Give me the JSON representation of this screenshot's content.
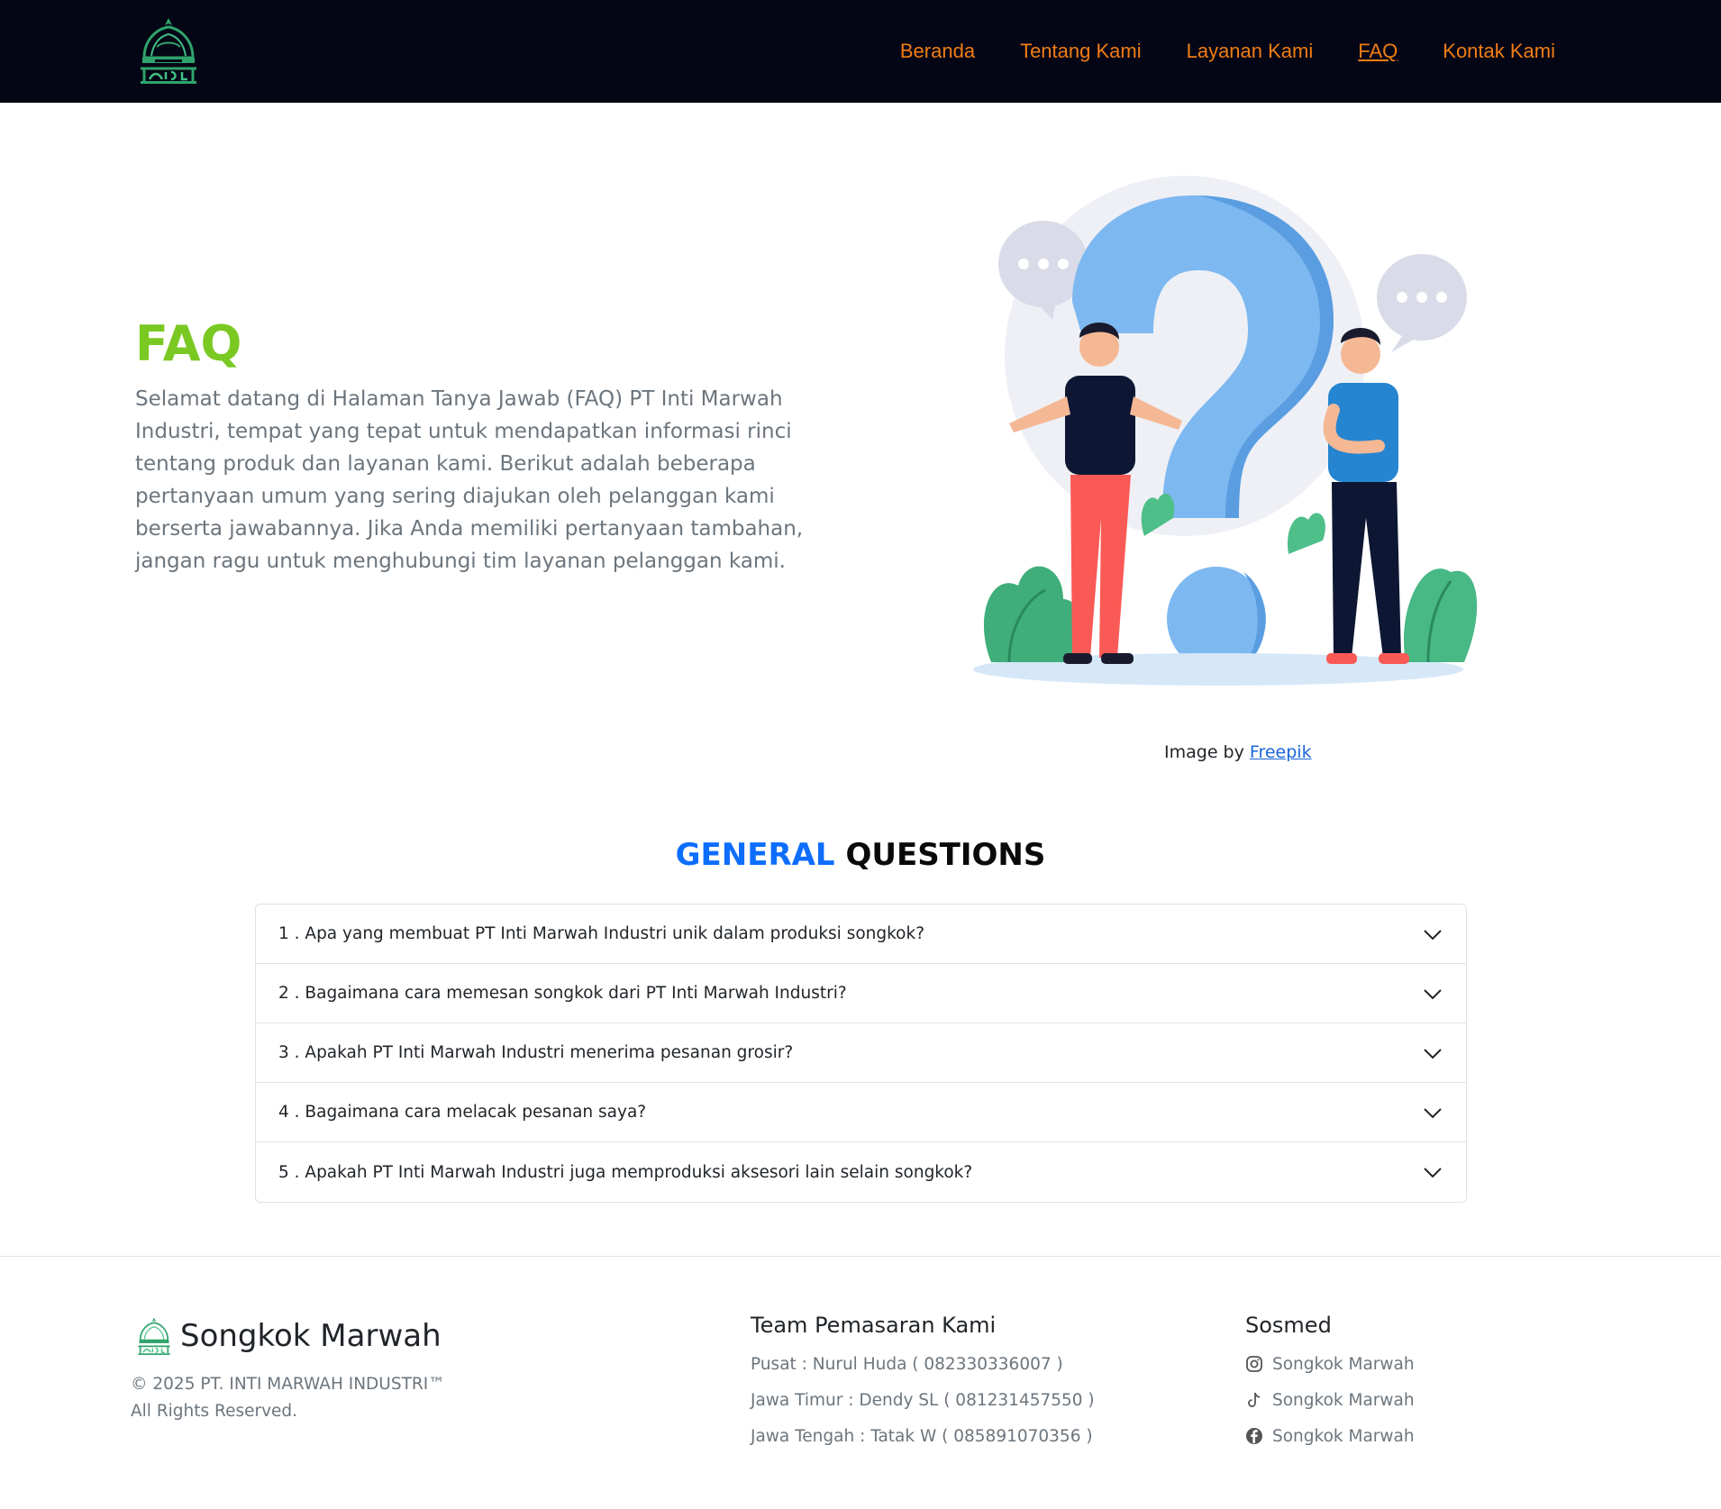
{
  "nav": {
    "links": [
      "Beranda",
      "Tentang Kami",
      "Layanan Kami",
      "FAQ",
      "Kontak Kami"
    ],
    "active": "FAQ",
    "link_color": "#f07d15",
    "bg_color": "#040615"
  },
  "hero": {
    "title": "FAQ",
    "text": "Selamat datang di Halaman Tanya Jawab (FAQ) PT Inti Marwah Industri, tempat yang tepat untuk mendapatkan informasi rinci tentang produk dan layanan kami. Berikut adalah beberapa pertanyaan umum yang sering diajukan oleh pelanggan kami berserta jawabannya. Jika Anda memiliki pertanyaan tambahan, jangan ragu untuk menghubungi tim layanan pelanggan kami.",
    "title_color": "#7ac922",
    "credit_prefix": "Image by",
    "credit_link": "Freepik"
  },
  "faq": {
    "title_highlight": "GENERAL",
    "title_rest": "QUESTIONS",
    "items": [
      "1 . Apa yang membuat PT Inti Marwah Industri unik dalam produksi songkok?",
      "2 . Bagaimana cara memesan songkok dari PT Inti Marwah Industri?",
      "3 . Apakah PT Inti Marwah Industri menerima pesanan grosir?",
      "4 . Bagaimana cara melacak pesanan saya?",
      "5 . Apakah PT Inti Marwah Industri juga memproduksi aksesori lain selain songkok?"
    ],
    "icon": "chevron-down-icon"
  },
  "footer": {
    "brand": "Songkok Marwah",
    "copyright": "© 2025 PT. INTI MARWAH INDUSTRI™",
    "rights": "All Rights Reserved.",
    "team_title": "Team Pemasaran Kami",
    "team": [
      "Pusat : Nurul Huda ( 082330336007 )",
      "Jawa Timur : Dendy SL ( 081231457550 )",
      "Jawa Tengah : Tatak W ( 085891070356 )"
    ],
    "social_title": "Sosmed",
    "social": [
      {
        "icon": "instagram-icon",
        "label": "Songkok Marwah"
      },
      {
        "icon": "tiktok-icon",
        "label": "Songkok Marwah"
      },
      {
        "icon": "facebook-icon",
        "label": "Songkok Marwah"
      }
    ]
  }
}
